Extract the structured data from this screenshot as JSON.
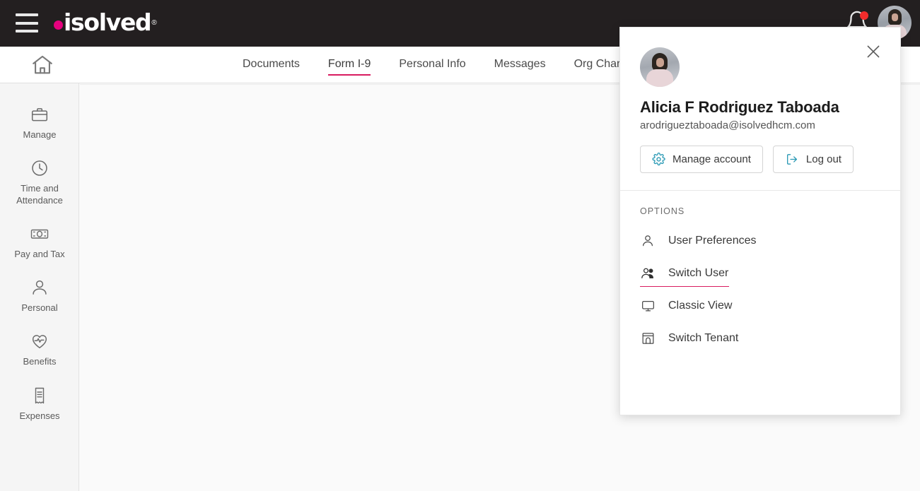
{
  "brand": {
    "logo_text": "isolved",
    "logo_registered": "®",
    "accent_pink": "#e6007e",
    "active_pink": "#d81b60",
    "topbar_bg": "#231f20",
    "icon_teal": "#2b9ab5"
  },
  "topbar": {
    "menu_icon": "hamburger-menu-icon",
    "notification_icon": "bell-icon",
    "notification_badge": "",
    "avatar_icon": "user-avatar"
  },
  "nav": {
    "home_icon": "home-icon",
    "items": [
      {
        "label": "Documents",
        "active": false
      },
      {
        "label": "Form I-9",
        "active": true
      },
      {
        "label": "Personal Info",
        "active": false
      },
      {
        "label": "Messages",
        "active": false
      },
      {
        "label": "Org Chart",
        "active": false
      }
    ]
  },
  "sidebar": {
    "items": [
      {
        "label": "Manage",
        "icon": "briefcase-icon"
      },
      {
        "label": "Time and Attendance",
        "icon": "clock-icon"
      },
      {
        "label": "Pay and Tax",
        "icon": "money-icon"
      },
      {
        "label": "Personal",
        "icon": "person-icon"
      },
      {
        "label": "Benefits",
        "icon": "heart-pulse-icon"
      },
      {
        "label": "Expenses",
        "icon": "receipt-icon"
      }
    ]
  },
  "account_menu": {
    "close_icon": "close-icon",
    "user_name": "Alicia F Rodriguez Taboada",
    "user_email": "arodrigueztaboada@isolvedhcm.com",
    "manage_account_label": "Manage account",
    "manage_account_icon": "gear-icon",
    "log_out_label": "Log out",
    "log_out_icon": "logout-icon",
    "options_heading": "OPTIONS",
    "options": [
      {
        "label": "User Preferences",
        "icon": "person-icon",
        "hovered": false
      },
      {
        "label": "Switch User",
        "icon": "people-icon",
        "hovered": true
      },
      {
        "label": "Classic View",
        "icon": "monitor-icon",
        "hovered": false
      },
      {
        "label": "Switch Tenant",
        "icon": "building-icon",
        "hovered": false
      }
    ]
  }
}
